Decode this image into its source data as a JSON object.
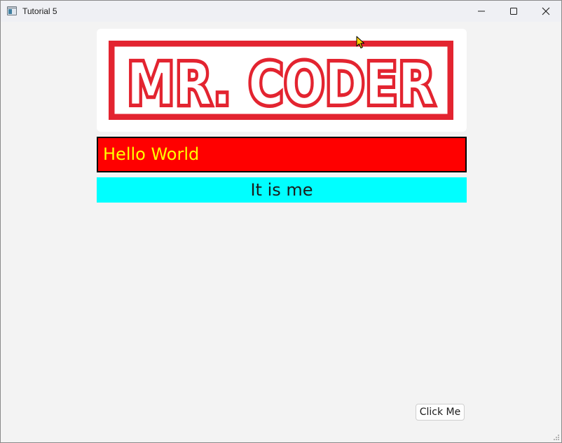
{
  "window": {
    "title": "Tutorial 5",
    "controls": {
      "minimize": "minimize-icon",
      "maximize": "maximize-icon",
      "close": "close-icon"
    }
  },
  "logo": {
    "text": "MR. CODER",
    "color": "#e32430"
  },
  "hello_label": {
    "text": "Hello World",
    "background": "#ff0000",
    "text_color": "#ffff00"
  },
  "me_label": {
    "text": "It is me",
    "background": "#00ffff"
  },
  "button": {
    "label": "Click Me"
  }
}
